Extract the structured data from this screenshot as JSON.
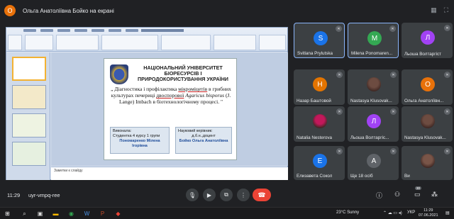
{
  "topbar": {
    "presenter_initial": "O",
    "presenter_text": "Ольга Анатоліївна Бойко на екрані"
  },
  "slide": {
    "university": "НАЦІОНАЛЬНИЙ УНІВЕРСИТЕТ БІОРЕСУРСІВ І ПРИРОДОКОРИСТУВАННЯ УКРАЇНИ",
    "title_1": "„ Діагностика і профілактика ",
    "title_u1": "мікроміцетів",
    "title_2": " в грибних культурах печериці ",
    "title_u2": "двоспорової",
    "title_3": " Agaricus bisporus",
    "title_4": " (J. Lange) Imbach в біотехнологічному процесі. \"",
    "performer_label": "Виконала:",
    "performer_desc": "Студентка 4 курсу 1 групи",
    "performer_name": "Пономаренко Мілена Ігорівна",
    "advisor_label": "Науковий керівник:",
    "advisor_degree": "д.б.н.,доцент",
    "advisor_name": "Бойко Ольга Анатоліївна",
    "notes": "Заметки к слайду"
  },
  "participants": [
    {
      "name": "Svitlana Prylutska",
      "initial": "S",
      "color": "#1a73e8",
      "highlight": true
    },
    {
      "name": "Milena Ponomaren...",
      "initial": "M",
      "color": "#34a853",
      "highlight": true
    },
    {
      "name": "Льоша Волтаргіст",
      "initial": "Л",
      "color": "#a142f4",
      "highlight": false
    },
    {
      "name": "Назар Баштовой",
      "initial": "Н",
      "color": "#e37400",
      "highlight": false
    },
    {
      "name": "Nastasya Klusovak...",
      "initial": "",
      "color": "#6d4c41",
      "highlight": false
    },
    {
      "name": "Ольга Анатоліївн...",
      "initial": "О",
      "color": "#e8710a",
      "highlight": false
    },
    {
      "name": "Natalia Nesterova",
      "initial": "",
      "color": "#c2185b",
      "highlight": false
    },
    {
      "name": "Льоша Волтаргіс...",
      "initial": "Л",
      "color": "#a142f4",
      "highlight": false
    },
    {
      "name": "Nastasya Klusovak...",
      "initial": "",
      "color": "#6d4c41",
      "highlight": false
    },
    {
      "name": "Елизавета Сокол",
      "initial": "Е",
      "color": "#1a73e8",
      "highlight": false
    },
    {
      "name": "Ще 18 осіб",
      "initial": "А",
      "color": "#5f6368",
      "highlight": false
    },
    {
      "name": "Ви",
      "initial": "",
      "color": "#795548",
      "highlight": false
    }
  ],
  "bottombar": {
    "time": "11:29",
    "meeting_code": "uyr-vmpq-ree",
    "participant_count": "30"
  },
  "taskbar": {
    "weather": "23°C  Sunny",
    "language": "УКР",
    "clock_time": "11:29",
    "clock_date": "07.06.2021"
  }
}
